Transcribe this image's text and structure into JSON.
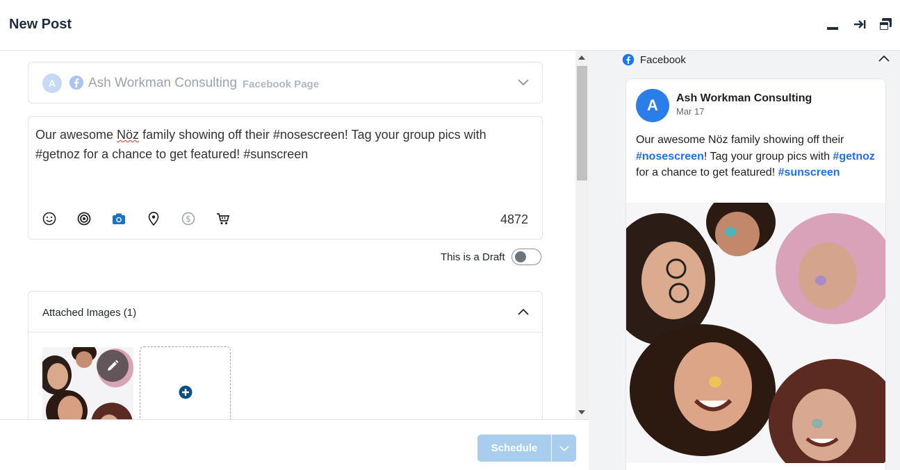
{
  "header": {
    "title": "New Post"
  },
  "account": {
    "avatar_letter": "A",
    "name": "Ash Workman Consulting",
    "type": "Facebook Page"
  },
  "compose": {
    "text_parts": [
      "Our awesome ",
      "Nöz",
      " family showing off their #nosescreen!  Tag your group pics with #getnoz for a chance to get featured! #sunscreen"
    ],
    "char_count": "4872",
    "tools": [
      "emoji-icon",
      "target-icon",
      "camera-icon",
      "location-pin-icon",
      "dollar-icon",
      "cart-icon"
    ]
  },
  "draft": {
    "label": "This is a Draft",
    "enabled": false
  },
  "images": {
    "title": "Attached Images (1)",
    "count": 1
  },
  "footer": {
    "schedule_label": "Schedule"
  },
  "preview": {
    "network": "Facebook",
    "page_name": "Ash Workman Consulting",
    "avatar_letter": "A",
    "date": "Mar 17",
    "text_parts": {
      "p1": "Our awesome Nöz family showing off their ",
      "h1": "#nosescreen",
      "p2": "! Tag your group pics with ",
      "h2": "#getnoz",
      "p3": " for a chance to get featured! ",
      "h3": "#sunscreen"
    }
  },
  "colors": {
    "facebook_blue": "#1877f2",
    "hashtag": "#216fdb",
    "schedule_disabled": "#a9cdec",
    "camera_active": "#1a73c7"
  }
}
